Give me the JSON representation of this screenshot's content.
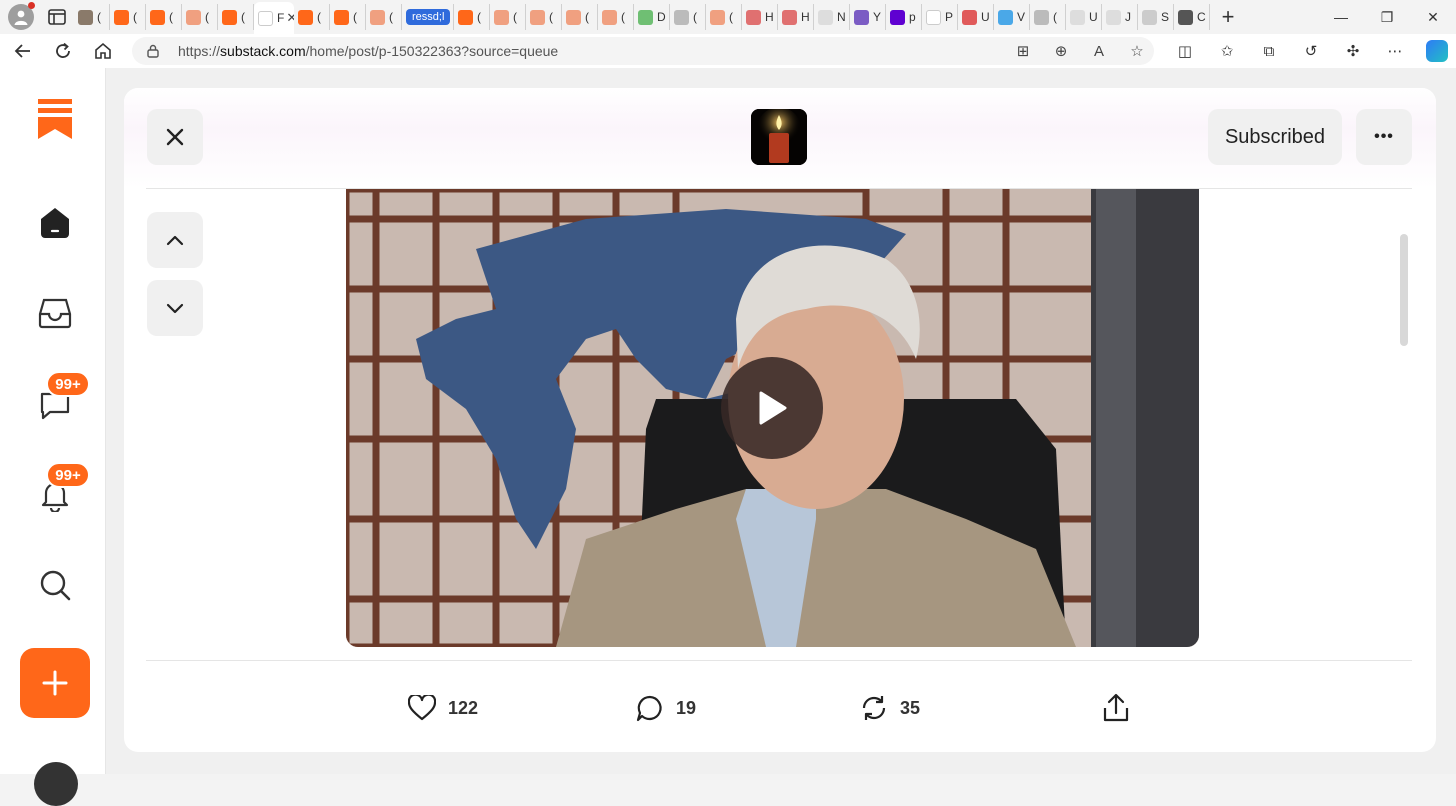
{
  "browser": {
    "tabs": [
      {
        "label": "(",
        "color": "#8a7a6a"
      },
      {
        "label": "(",
        "color": "#ff6719"
      },
      {
        "label": "(",
        "color": "#ff6719"
      },
      {
        "label": "(",
        "color": "#f0a080"
      },
      {
        "label": "(",
        "color": "#ff6719"
      },
      {
        "label": "F",
        "color": "#ffffff",
        "active": true
      },
      {
        "label": "(",
        "color": "#ff6719"
      },
      {
        "label": "(",
        "color": "#ff6719"
      },
      {
        "label": "(",
        "color": "#f0a080"
      },
      {
        "label": "ressd;l",
        "pill": true
      },
      {
        "label": "(",
        "color": "#ff6719"
      },
      {
        "label": "(",
        "color": "#f0a080"
      },
      {
        "label": "(",
        "color": "#f0a080"
      },
      {
        "label": "(",
        "color": "#f0a080"
      },
      {
        "label": "(",
        "color": "#f0a080"
      },
      {
        "label": "D",
        "color": "#6fbf73"
      },
      {
        "label": "(",
        "color": "#bbbbbb"
      },
      {
        "label": "(",
        "color": "#f0a080"
      },
      {
        "label": "H",
        "color": "#e07070"
      },
      {
        "label": "H",
        "color": "#e07070"
      },
      {
        "label": "N",
        "color": "#dddddd"
      },
      {
        "label": "Y",
        "color": "#7b5cc4"
      },
      {
        "label": "p",
        "color": "#5f01d1"
      },
      {
        "label": "P",
        "color": "#ffffff"
      },
      {
        "label": "U",
        "color": "#e05a5a"
      },
      {
        "label": "V",
        "color": "#4aa8e8"
      },
      {
        "label": "(",
        "color": "#bbbbbb"
      },
      {
        "label": "U",
        "color": "#dddddd"
      },
      {
        "label": "J",
        "color": "#dddddd"
      },
      {
        "label": "S",
        "color": "#cccccc"
      },
      {
        "label": "C",
        "color": "#555555"
      }
    ],
    "active_tab_close": "✕",
    "new_tab": "+",
    "window_controls": {
      "minimize": "—",
      "restore": "❐",
      "close": "✕"
    },
    "url_prefix": "https://",
    "url_host": "substack.com",
    "url_path": "/home/post/p-150322363?source=queue"
  },
  "sidebar": {
    "chat_badge": "99+",
    "notifications_badge": "99+",
    "brand_color": "#ff6719"
  },
  "post": {
    "subscribe_label": "Subscribed",
    "more_label": "•••",
    "likes": "122",
    "comments": "19",
    "restacks": "35"
  }
}
